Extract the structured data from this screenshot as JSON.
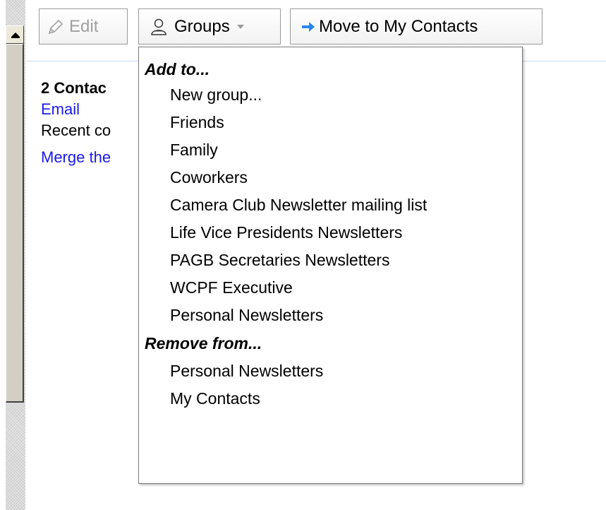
{
  "toolbar": {
    "edit_label": "Edit",
    "groups_label": "Groups",
    "move_label": "Move to My Contacts"
  },
  "summary": {
    "title": "2 Contac",
    "email_link": "Email",
    "recent_text": "Recent co",
    "merge_link": "Merge the"
  },
  "menu": {
    "add_header": "Add to...",
    "add_items": [
      "New group...",
      "Friends",
      "Family",
      "Coworkers",
      "Camera Club Newsletter mailing list",
      "Life Vice Presidents Newsletters",
      "PAGB Secretaries Newsletters",
      "WCPF Executive",
      "Personal Newsletters"
    ],
    "remove_header": "Remove from...",
    "remove_items": [
      "Personal Newsletters",
      "My Contacts"
    ]
  },
  "icons": {
    "edit": "pencil-icon",
    "groups": "person-icon",
    "move": "arrow-right-icon",
    "dropdown": "chevron-down-icon"
  },
  "colors": {
    "link": "#1a1ae8",
    "move_arrow": "#2a86f0"
  }
}
